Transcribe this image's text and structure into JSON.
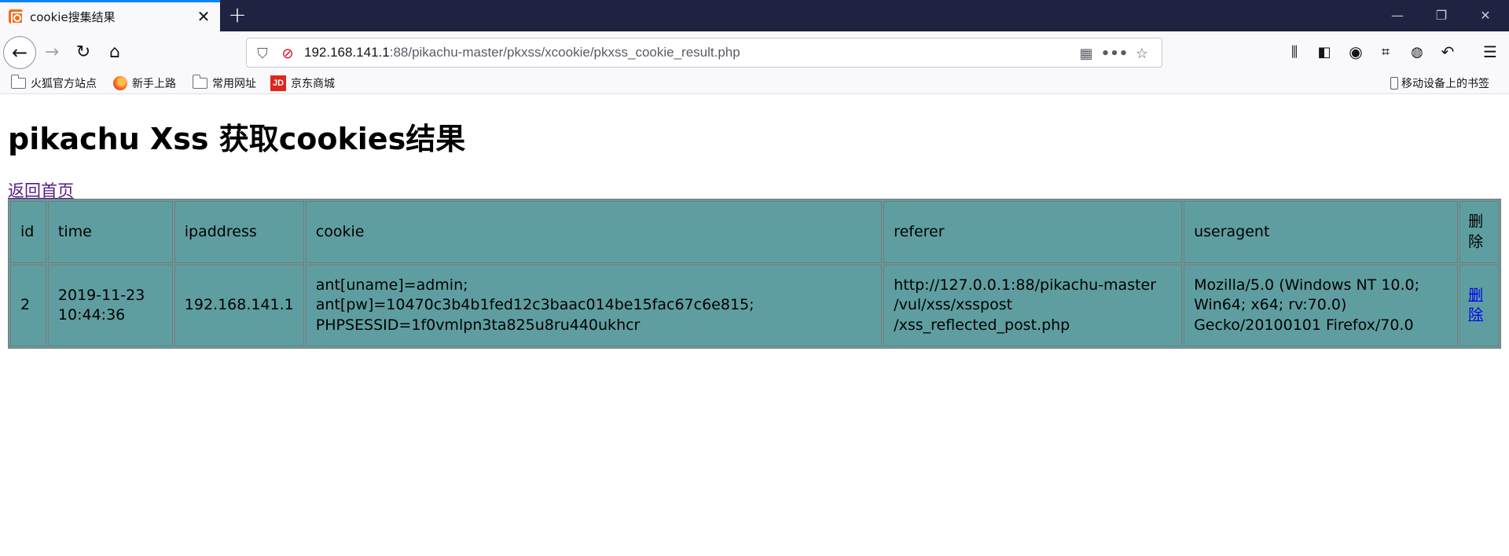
{
  "browser": {
    "tab_title": "cookie搜集结果",
    "url_host": "192.168.141.1",
    "url_rest": ":88/pikachu-master/pkxss/xcookie/pkxss_cookie_result.php"
  },
  "bookmarks": {
    "items": [
      "火狐官方站点",
      "新手上路",
      "常用网址",
      "京东商城"
    ],
    "jd_badge": "JD",
    "mobile": "移动设备上的书签"
  },
  "page": {
    "title": "pikachu Xss 获取cookies结果",
    "home_link": "返回首页"
  },
  "table": {
    "headers": [
      "id",
      "time",
      "ipaddress",
      "cookie",
      "referer",
      "useragent",
      "删除"
    ],
    "rows": [
      {
        "id": "2",
        "time": [
          "2019-11-23",
          "10:44:36"
        ],
        "ipaddress": "192.168.141.1",
        "cookie": [
          "ant[uname]=admin;",
          "ant[pw]=10470c3b4b1fed12c3baac014be15fac67c6e815;",
          "PHPSESSID=1f0vmlpn3ta825u8ru440ukhcr"
        ],
        "referer": [
          "http://127.0.0.1:88/pikachu-master",
          "/vul/xss/xsspost",
          "/xss_reflected_post.php"
        ],
        "useragent": [
          "Mozilla/5.0 (Windows NT 10.0;",
          "Win64; x64; rv:70.0)",
          "Gecko/20100101 Firefox/70.0"
        ],
        "delete": "删除"
      }
    ]
  }
}
